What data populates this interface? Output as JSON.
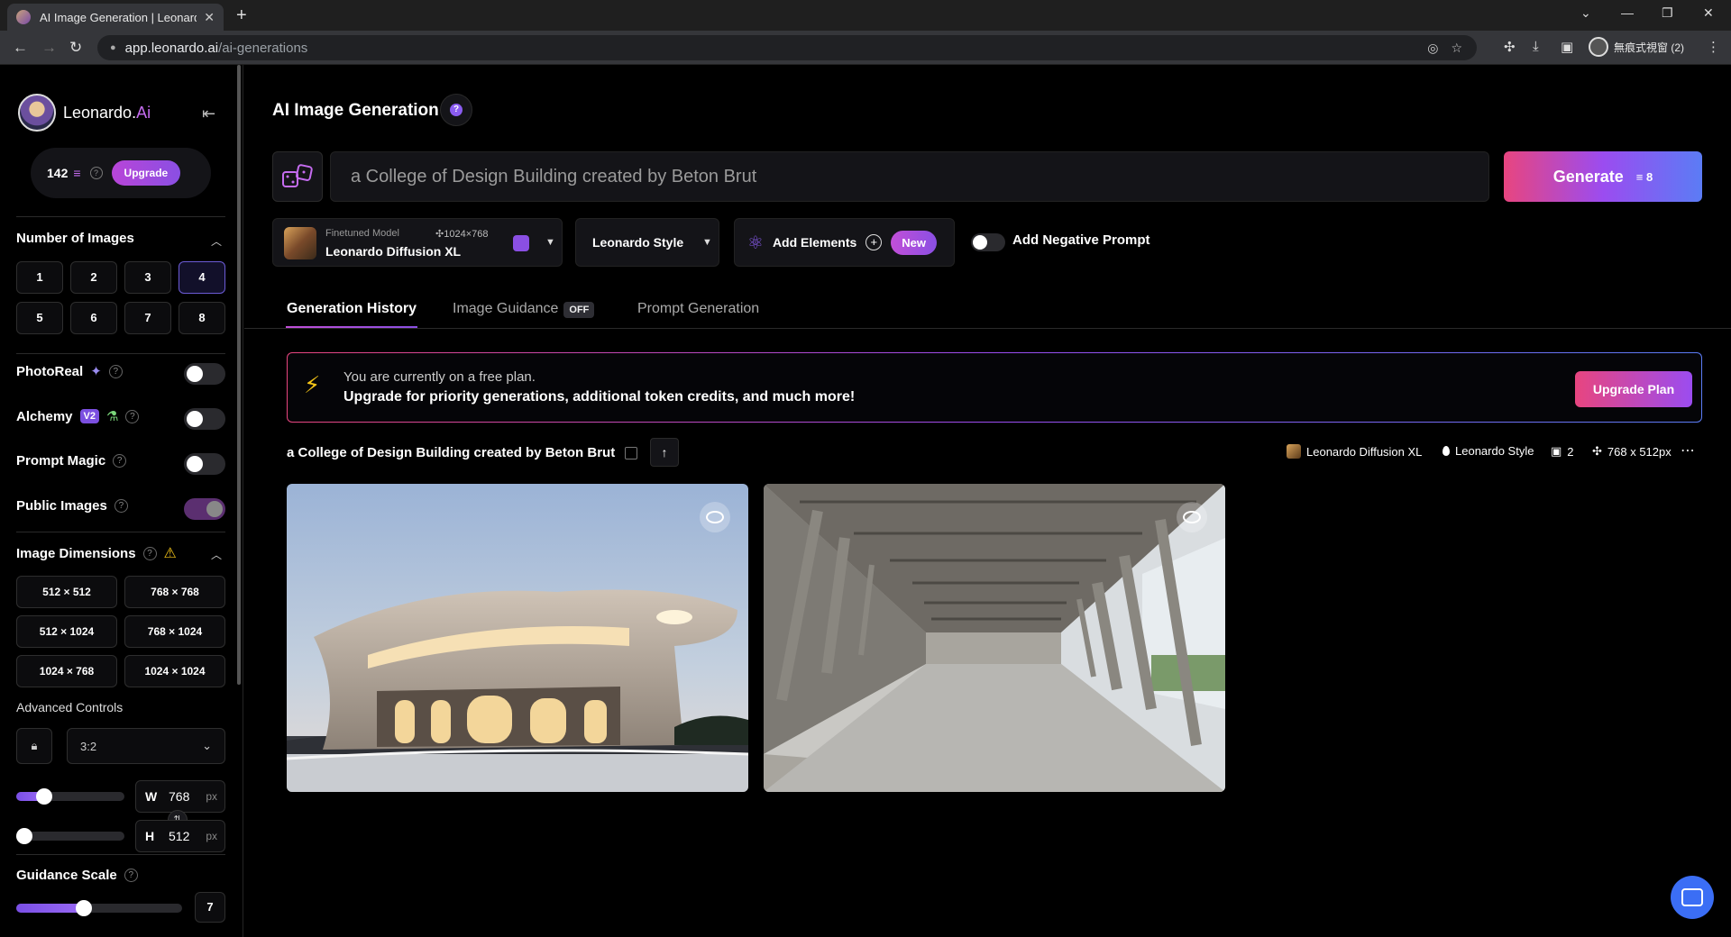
{
  "browser": {
    "tab_title": "AI Image Generation | Leonardo",
    "url_host": "app.leonardo.ai",
    "url_path": "/ai-generations",
    "profile_label": "無痕式視窗 (2)"
  },
  "sidebar": {
    "brand": "Leonardo.",
    "brand_suffix": "Ai",
    "tokens": "142",
    "upgrade": "Upgrade",
    "num_images_title": "Number of Images",
    "num_options": [
      "1",
      "2",
      "3",
      "4",
      "5",
      "6",
      "7",
      "8"
    ],
    "num_selected": "4",
    "photoreal": "PhotoReal",
    "alchemy": "Alchemy",
    "alchemy_badge": "V2",
    "prompt_magic": "Prompt Magic",
    "public_images": "Public Images",
    "dims_title": "Image Dimensions",
    "dims": [
      "512 × 512",
      "768 × 768",
      "512 × 1024",
      "768 × 1024",
      "1024 × 768",
      "1024 × 1024"
    ],
    "advanced": "Advanced Controls",
    "ratio": "3:2",
    "width_key": "W",
    "width": "768",
    "height_key": "H",
    "height": "512",
    "unit": "px",
    "width_slider_fraction": 0.22,
    "height_slider_fraction": 0.0,
    "guidance_title": "Guidance Scale",
    "guidance_value": "7",
    "guidance_fraction": 0.4
  },
  "main": {
    "title": "AI Image Generation",
    "prompt": "a College of Design Building created by Beton Brut",
    "generate": "Generate",
    "generate_cost": "8",
    "model_kind": "Finetuned Model",
    "model_size": "1024×768",
    "model_name": "Leonardo Diffusion XL",
    "style": "Leonardo Style",
    "add_elements": "Add Elements",
    "new_badge": "New",
    "neg_prompt": "Add Negative Prompt",
    "tabs": {
      "history": "Generation History",
      "guidance": "Image Guidance",
      "guidance_badge": "OFF",
      "prompt_gen": "Prompt Generation"
    },
    "banner": {
      "line1": "You are currently on a free plan.",
      "line2": "Upgrade for priority generations, additional token credits, and much more!",
      "button": "Upgrade Plan"
    },
    "generation": {
      "prompt": "a College of Design Building created by Beton Brut",
      "model": "Leonardo Diffusion XL",
      "style": "Leonardo Style",
      "count": "2",
      "size": "768 x 512px"
    }
  },
  "colors": {
    "accent_purple": "#8a4fe3",
    "accent_pink": "#e8457f",
    "accent_blue": "#5b7cf5"
  }
}
